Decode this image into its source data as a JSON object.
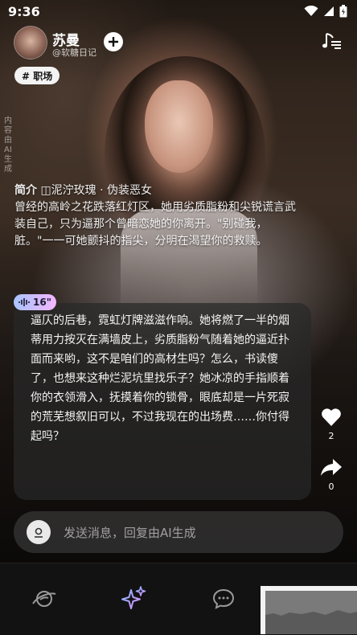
{
  "status_bar": {
    "time": "9:36"
  },
  "profile": {
    "name": "苏曼",
    "handle": "@软糖日记",
    "tag": "# 职场"
  },
  "ai_watermark": "内容由AI生成",
  "intro": {
    "title": "简介",
    "text": " ◫泥泞玫瑰 · 伪装恶女\n曾经的高岭之花跌落红灯区，她用劣质脂粉和尖锐谎言武装自己，只为逼那个曾暗恋她的你离开。\"别碰我，脏。\"一一可她颤抖的指尖，分明在渴望你的救赎。"
  },
  "message": {
    "badge": "16\"",
    "text": "逼仄的后巷，霓虹灯牌滋滋作响。她将燃了一半的烟蒂用力按灭在满墙皮上，劣质脂粉气随着她的逼近扑面而来哟，这不是咱们的高材生吗？怎么，书读傻了，也想来这种烂泥坑里找乐子？她冰凉的手指顺着你的衣领滑入，抚摸着你的锁骨，眼底却是一片死寂的荒芜想叙旧可以，不过我现在的出场费……你付得起吗？"
  },
  "actions": {
    "likes": "2",
    "shares": "0"
  },
  "input": {
    "placeholder": "发送消息，回复由AI生成"
  },
  "icons": {
    "music": "music-note-icon",
    "like": "heart-icon",
    "share": "share-arrow-icon",
    "input": "mic-icon",
    "nav_home": "planet-icon",
    "nav_ai": "sparkle-icon",
    "nav_chat": "chat-bubble-icon"
  },
  "colors": {
    "badge_start": "#a7c4ff",
    "badge_end": "#f4b6ff",
    "sparkle_start": "#7fb7ff",
    "sparkle_end": "#e08cff"
  }
}
